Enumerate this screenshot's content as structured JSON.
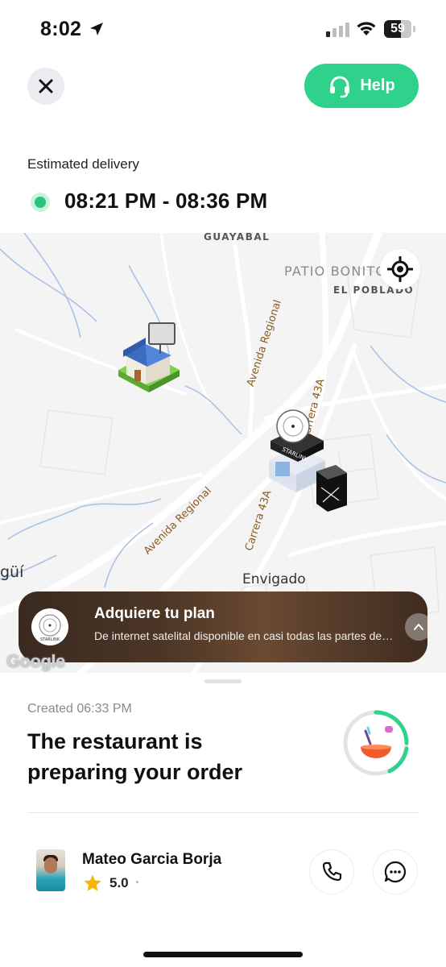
{
  "status_bar": {
    "time": "8:02",
    "battery": "59"
  },
  "header": {
    "close_icon": "close-icon",
    "help_label": "Help",
    "help_icon": "headset-icon",
    "accent_color": "#2fd28a"
  },
  "delivery": {
    "label": "Estimated delivery",
    "window": "08:21 PM - 08:36 PM",
    "status_color": "#27c47a"
  },
  "map": {
    "labels": {
      "guayabal": "GUAYABAL",
      "patio_bonito": "PATIO BONITO",
      "el_poblado": "EL POBLADO",
      "avenida_regional_1": "Avenida Regional",
      "avenida_regional_2": "Avenida Regional",
      "carrera_43a_1": "Carrera 43A",
      "carrera_43a_2": "Carrera 43A",
      "envigado": "Envigado",
      "itagui_partial": "güí",
      "watermark": "Google"
    },
    "markers": [
      "house-marker",
      "store-marker",
      "phone-marker"
    ]
  },
  "promo_banner": {
    "title": "Adquiere tu plan",
    "subtitle": "De internet satelital disponible en casi todas las partes del país",
    "logo_text": "STARLINK"
  },
  "order": {
    "created": "Created 06:33 PM",
    "status": "The restaurant is preparing your order",
    "progress_icon": "food-bowl-icon"
  },
  "driver": {
    "name": "Mateo Garcia Borja",
    "rating": "5.0"
  }
}
